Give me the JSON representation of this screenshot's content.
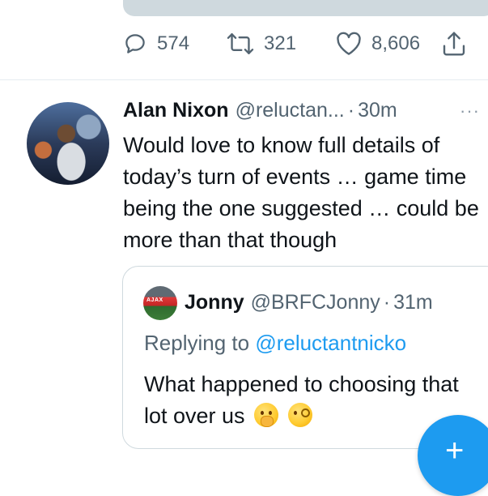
{
  "previous_tweet": {
    "actions": {
      "reply_count": "574",
      "retweet_count": "321",
      "like_count": "8,606"
    }
  },
  "tweet": {
    "author_name": "Alan Nixon",
    "author_handle": "@reluctan...",
    "separator": "·",
    "time": "30m",
    "more_label": "···",
    "text": "Would love to know full details of today’s turn of events … game time being the one suggested … could be more than that though",
    "quoted": {
      "author_name": "Jonny",
      "author_handle": "@BRFCJonny",
      "separator": "·",
      "time": "31m",
      "replying_prefix": "Replying to",
      "replying_to": "@reluctantnicko",
      "text": "What happened to choosing that lot over us",
      "avatar_badge": "AJAX"
    }
  },
  "fab": {
    "label": "+"
  },
  "icons": {
    "reply": "reply-icon",
    "retweet": "retweet-icon",
    "like": "heart-icon",
    "share": "share-icon",
    "more": "more-icon",
    "compose": "plus-icon",
    "emoji_1": "shushing-face-emoji-icon",
    "emoji_2": "face-with-monocle-emoji-icon"
  },
  "colors": {
    "accent": "#1d9bf0",
    "text": "#0f1419",
    "muted": "#536471",
    "border": "#cfd9de"
  }
}
